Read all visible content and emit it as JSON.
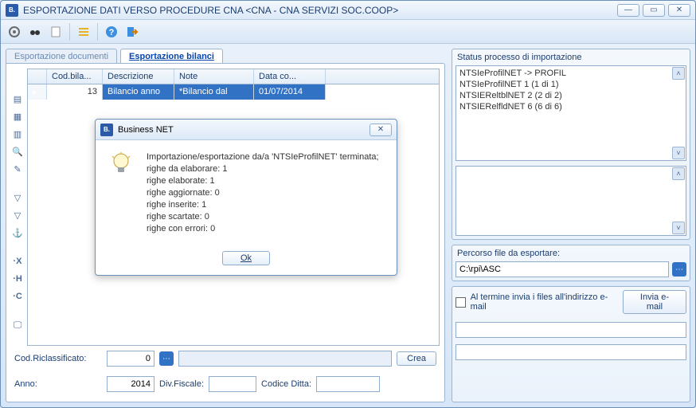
{
  "window": {
    "title": "ESPORTAZIONE DATI VERSO PROCEDURE CNA <CNA - CNA SERVIZI SOC.COOP>",
    "app_badge": "B."
  },
  "tabs": {
    "documents": "Esportazione documenti",
    "bilanci": "Esportazione bilanci"
  },
  "grid": {
    "headers": {
      "cod": "Cod.bila...",
      "descr": "Descrizione",
      "note": "Note",
      "data": "Data co..."
    },
    "row": {
      "cod": "13",
      "descr": "Bilancio anno",
      "note": "*Bilancio dal",
      "data": "01/07/2014"
    }
  },
  "form": {
    "riclass_label": "Cod.Riclassificato:",
    "riclass_value": "0",
    "crea": "Crea",
    "anno_label": "Anno:",
    "anno_value": "2014",
    "div_label": "Div.Fiscale:",
    "ditta_label": "Codice Ditta:"
  },
  "status": {
    "title": "Status processo di importazione",
    "lines": [
      "NTSIeProfilNET -> PROFIL",
      "NTSIeProfilNET 1 (1 di 1)",
      "NTSIEReltblNET 2 (2 di 2)",
      "NTSIERelfldNET 6 (6 di 6)"
    ]
  },
  "path": {
    "title": "Percorso file da esportare:",
    "value": "C:\\rpi\\ASC"
  },
  "email": {
    "check_label": "Al termine invia i files all'indirizzo e-mail",
    "send": "Invia e-mail"
  },
  "dialog": {
    "title": "Business NET",
    "line1": "Importazione/esportazione da/a 'NTSIeProfilNET' terminata;",
    "line2": "righe da elaborare: 1",
    "line3": "righe elaborate: 1",
    "line4": "righe aggiornate: 0",
    "line5": "righe inserite: 1",
    "line6": "righe scartate: 0",
    "line7": "righe con errori: 0",
    "ok": "Ok"
  }
}
